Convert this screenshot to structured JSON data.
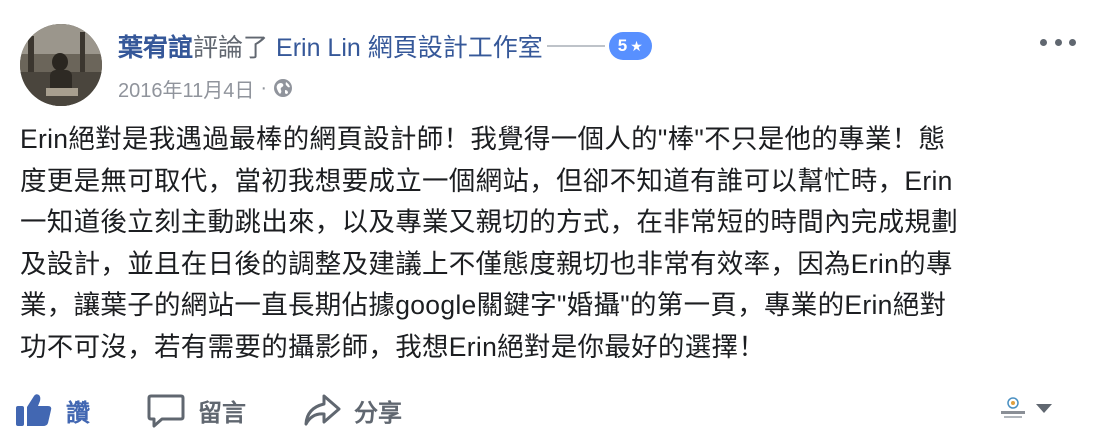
{
  "post": {
    "author": "葉宥誼",
    "verb": "評論了",
    "page_name": "Erin Lin 網頁設計工作室",
    "rating": "5",
    "rating_star": "★",
    "date": "2016年11月4日",
    "dot": "·",
    "privacy_icon": "globe-icon",
    "text_lines": [
      "Erin絕對是我遇過最棒的網頁設計師！我覺得一個人的\"棒\"不只是他的專業！態",
      "度更是無可取代，當初我想要成立一個網站，但卻不知道有誰可以幫忙時，Erin",
      "一知道後立刻主動跳出來，以及專業又親切的方式，在非常短的時間內完成規劃",
      "及設計，並且在日後的調整及建議上不僅態度親切也非常有效率，因為Erin的專",
      "業，讓葉子的網站一直長期佔據google關鍵字\"婚攝\"的第一頁，專業的Erin絕對",
      "功不可沒，若有需要的攝影師，我想Erin絕對是你最好的選擇！"
    ]
  },
  "actions": {
    "like_label": "讚",
    "comment_label": "留言",
    "share_label": "分享"
  },
  "colors": {
    "link": "#365899",
    "like_blue": "#4267b2",
    "badge_blue": "#5890ff",
    "meta_gray": "#90949c",
    "action_gray": "#606770"
  }
}
